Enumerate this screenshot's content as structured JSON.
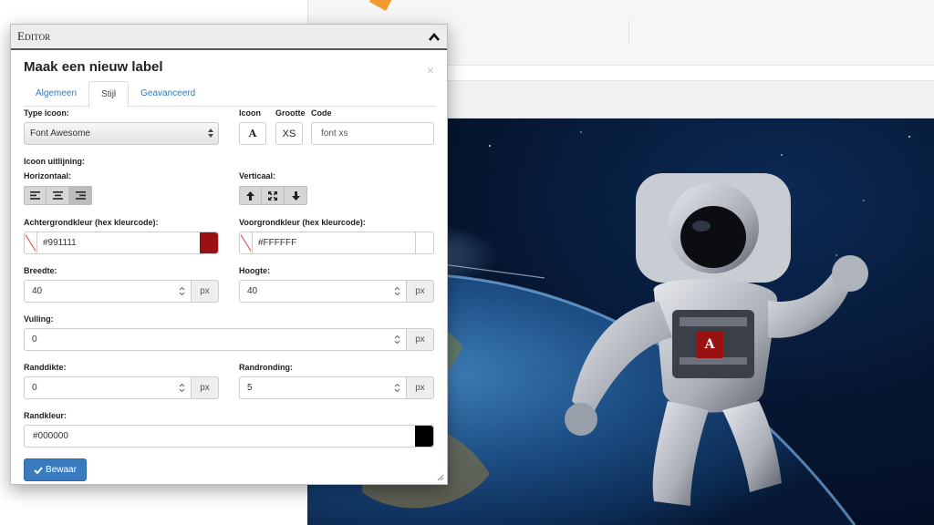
{
  "editor": {
    "window_title": "Editor",
    "dialog_title": "Maak een nieuw label",
    "close_symbol": "×",
    "tabs": [
      {
        "label": "Algemeen",
        "active": false
      },
      {
        "label": "Stijl",
        "active": true
      },
      {
        "label": "Geavanceerd",
        "active": false
      }
    ],
    "type_icon": {
      "label": "Type icoon:",
      "value": "Font Awesome"
    },
    "icon": {
      "label": "Icoon",
      "value": "A"
    },
    "size": {
      "label": "Grootte",
      "value": "XS"
    },
    "code": {
      "label": "Code",
      "value": "font xs"
    },
    "alignment": {
      "label": "Icoon uitlijning:",
      "horizontal_label": "Horizontaal:",
      "vertical_label": "Verticaal:"
    },
    "background_color": {
      "label": "Achtergrondkleur (hex kleurcode):",
      "value": "#991111",
      "swatch": "#991111"
    },
    "foreground_color": {
      "label": "Voorgrondkleur (hex kleurcode):",
      "value": "#FFFFFF",
      "swatch": "#FFFFFF"
    },
    "width": {
      "label": "Breedte:",
      "value": "40",
      "unit": "px"
    },
    "height": {
      "label": "Hoogte:",
      "value": "40",
      "unit": "px"
    },
    "padding": {
      "label": "Vulling:",
      "value": "0",
      "unit": "px"
    },
    "border_width": {
      "label": "Randdikte:",
      "value": "0",
      "unit": "px"
    },
    "border_radius": {
      "label": "Randronding:",
      "value": "5",
      "unit": "px"
    },
    "border_color": {
      "label": "Randkleur:",
      "value": "#000000",
      "swatch": "#000000"
    },
    "save_label": "Bewaar"
  },
  "preview": {
    "marker_text": "A",
    "marker_background": "#991111",
    "marker_foreground": "#FFFFFF"
  },
  "colors": {
    "accent": "#3a7bbf",
    "link": "#337ab7",
    "arrow": "#f47b20"
  }
}
